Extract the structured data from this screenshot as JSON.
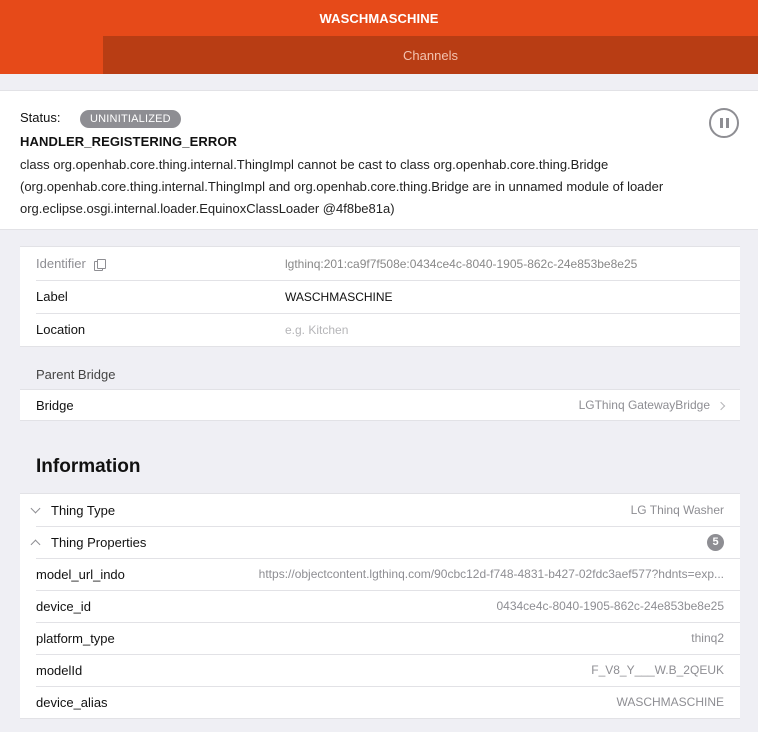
{
  "header": {
    "title": "WASCHMASCHINE",
    "tab": "Channels"
  },
  "status": {
    "label": "Status:",
    "badge": "UNINITIALIZED",
    "detail": "HANDLER_REGISTERING_ERROR",
    "description": "class org.openhab.core.thing.internal.ThingImpl cannot be cast to class org.openhab.core.thing.Bridge (org.openhab.core.thing.internal.ThingImpl and org.openhab.core.thing.Bridge are in unnamed module of loader org.eclipse.osgi.internal.loader.EquinoxClassLoader @4f8be81a)"
  },
  "thing": {
    "identifier_label": "Identifier",
    "identifier_value": "lgthinq:201:ca9f7f508e:0434ce4c-8040-1905-862c-24e853be8e25",
    "label_label": "Label",
    "label_value": "WASCHMASCHINE",
    "location_label": "Location",
    "location_placeholder": "e.g. Kitchen"
  },
  "parent_bridge": {
    "section_title": "Parent Bridge",
    "bridge_label": "Bridge",
    "bridge_value": "LGThinq GatewayBridge"
  },
  "information": {
    "title": "Information",
    "thing_type_label": "Thing Type",
    "thing_type_value": "LG Thinq Washer",
    "properties_label": "Thing Properties",
    "properties_count": "5",
    "properties": [
      {
        "key": "model_url_indo",
        "value": "https://objectcontent.lgthinq.com/90cbc12d-f748-4831-b427-02fdc3aef577?hdnts=exp..."
      },
      {
        "key": "device_id",
        "value": "0434ce4c-8040-1905-862c-24e853be8e25"
      },
      {
        "key": "platform_type",
        "value": "thinq2"
      },
      {
        "key": "modelId",
        "value": "F_V8_Y___W.B_2QEUK"
      },
      {
        "key": "device_alias",
        "value": "WASCHMASCHINE"
      }
    ]
  },
  "colors": {
    "accent": "#e64a19",
    "tab_bg": "#b83d14",
    "badge": "#8e8e93"
  },
  "icons": {
    "pause": "pause-circle-icon",
    "copy": "copy-icon",
    "chevron": "chevron-right-icon"
  }
}
